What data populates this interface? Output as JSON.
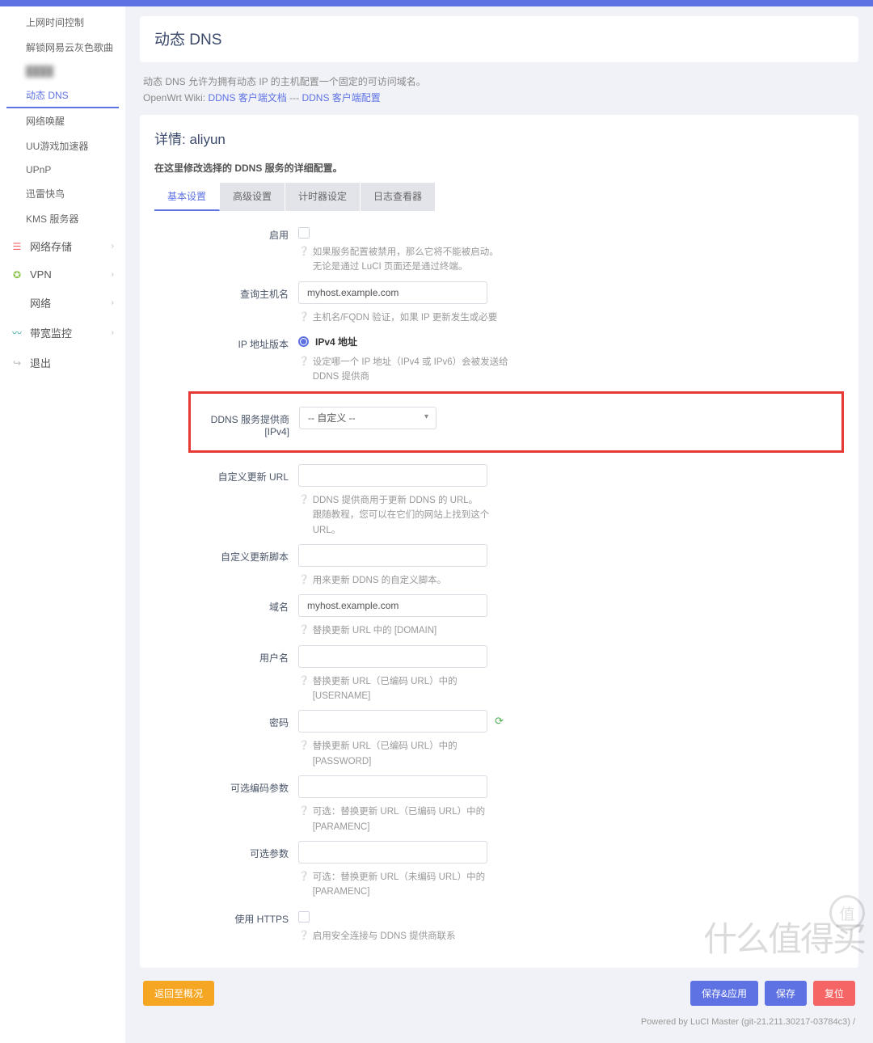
{
  "sidebar": {
    "items": [
      {
        "label": "上网时间控制"
      },
      {
        "label": "解锁网易云灰色歌曲"
      },
      {
        "label": "████"
      },
      {
        "label": "动态 DNS"
      },
      {
        "label": "网络唤醒"
      },
      {
        "label": "UU游戏加速器"
      },
      {
        "label": "UPnP"
      },
      {
        "label": "迅雷快鸟"
      },
      {
        "label": "KMS 服务器"
      }
    ],
    "groups": [
      {
        "label": "网络存储",
        "icon": "storage",
        "color": "#f56565"
      },
      {
        "label": "VPN",
        "icon": "globe",
        "color": "#8bc34a"
      },
      {
        "label": "网络",
        "icon": "network",
        "color": "#5e72e4"
      },
      {
        "label": "带宽监控",
        "icon": "monitor",
        "color": "#26a69a"
      },
      {
        "label": "退出",
        "icon": "logout",
        "color": "#bbb"
      }
    ]
  },
  "header": {
    "title": "动态 DNS",
    "desc_pre": "动态 DNS 允许为拥有动态 IP 的主机配置一个固定的可访问域名。",
    "wiki_label": "OpenWrt Wiki: ",
    "link1": "DDNS 客户端文档",
    "sep": " --- ",
    "link2": "DDNS 客户端配置"
  },
  "detail": {
    "title": "详情: aliyun",
    "subdesc": "在这里修改选择的 DDNS 服务的详细配置。"
  },
  "tabs": [
    "基本设置",
    "高级设置",
    "计时器设定",
    "日志查看器"
  ],
  "fields": {
    "enable": {
      "label": "启用",
      "hint": "如果服务配置被禁用，那么它将不能被启动。\n无论是通过 LuCI 页面还是通过终端。"
    },
    "lookup": {
      "label": "查询主机名",
      "value": "myhost.example.com",
      "hint": "主机名/FQDN 验证，如果 IP 更新发生或必要"
    },
    "ipver": {
      "label": "IP 地址版本",
      "opt": "IPv4 地址",
      "hint": "设定哪一个 IP 地址（IPv4 或 IPv6）会被发送给 DDNS 提供商"
    },
    "provider": {
      "label": "DDNS 服务提供商 [IPv4]",
      "value": "-- 自定义 --"
    },
    "custom_url": {
      "label": "自定义更新 URL",
      "value": "",
      "hint": "DDNS 提供商用于更新 DDNS 的 URL。\n跟随教程，您可以在它们的网站上找到这个 URL。"
    },
    "custom_script": {
      "label": "自定义更新脚本",
      "value": "",
      "hint": "用来更新 DDNS 的自定义脚本。"
    },
    "domain": {
      "label": "域名",
      "value": "myhost.example.com",
      "hint": "替换更新 URL 中的 [DOMAIN]"
    },
    "username": {
      "label": "用户名",
      "value": "",
      "hint": "替换更新 URL（已编码 URL）中的 [USERNAME]"
    },
    "password": {
      "label": "密码",
      "value": "",
      "hint": "替换更新 URL（已编码 URL）中的 [PASSWORD]"
    },
    "paramenc": {
      "label": "可选编码参数",
      "value": "",
      "hint": "可选：替换更新 URL（已编码 URL）中的 [PARAMENC]"
    },
    "paramopt": {
      "label": "可选参数",
      "value": "",
      "hint": "可选：替换更新 URL（未编码 URL）中的 [PARAMENC]"
    },
    "https": {
      "label": "使用 HTTPS",
      "hint": "启用安全连接与 DDNS 提供商联系"
    }
  },
  "buttons": {
    "back": "返回至概况",
    "save_apply": "保存&应用",
    "save": "保存",
    "reset": "复位"
  },
  "footer": "Powered by LuCI Master (git-21.211.30217-03784c3) / ",
  "watermark": "什么值得买",
  "wm_small": "值"
}
